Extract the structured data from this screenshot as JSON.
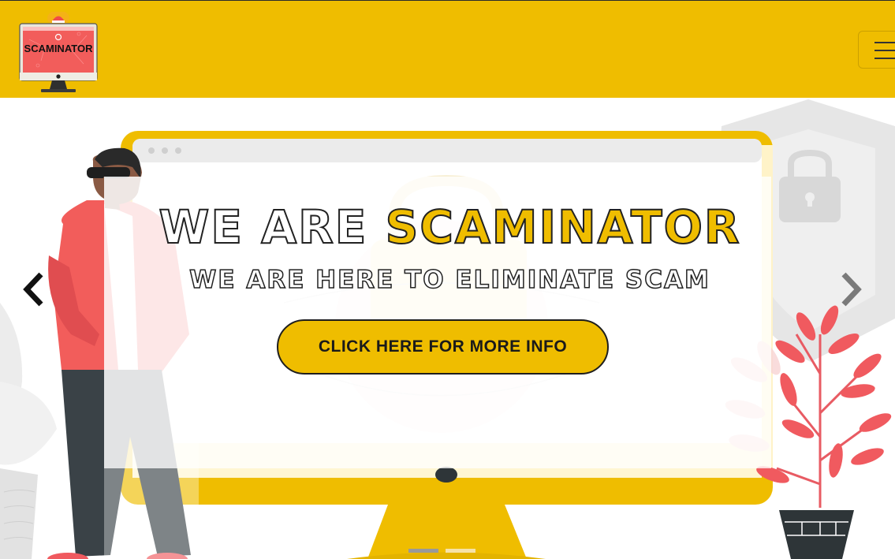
{
  "brand": {
    "logo_text": "SCAMINATOR",
    "colors": {
      "brand_yellow": "#EFBD00",
      "accent_red": "#F05A5F",
      "dark": "#2E3538"
    }
  },
  "navbar": {
    "toggler_icon": "hamburger-menu-icon"
  },
  "hero": {
    "title_prefix": "WE ARE ",
    "title_brand": "SCAMINATOR",
    "subtitle": "WE ARE HERE TO ELIMINATE SCAM",
    "cta_label": "CLICK HERE FOR MORE INFO",
    "prev_icon": "chevron-left-icon",
    "next_icon": "chevron-right-icon",
    "indicators": {
      "count": 2,
      "active_index": 0
    }
  }
}
